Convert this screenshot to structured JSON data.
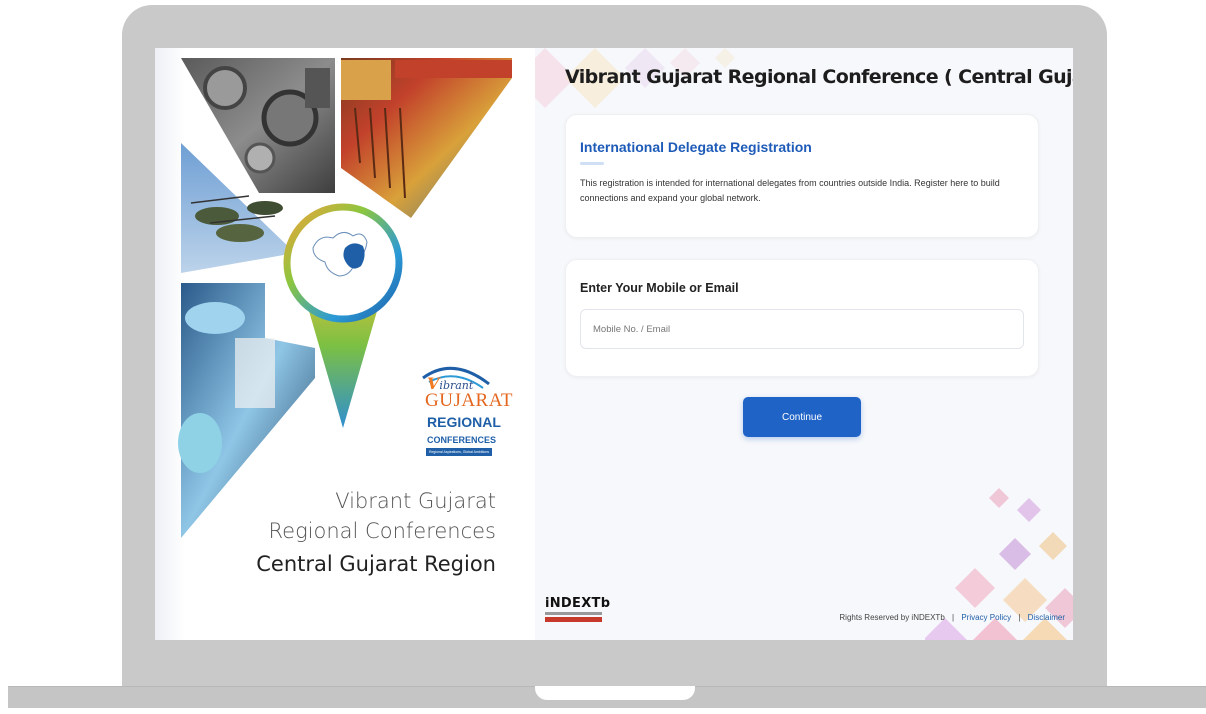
{
  "left": {
    "logo": {
      "vibrant": "ibrant",
      "vibrant_initial": "V",
      "gujarat": "GUJARAT",
      "regional": "REGIONAL",
      "conferences": "CONFERENCES",
      "tagline": "Regional Aspirations, Global Ambitions"
    },
    "title_line1": "Vibrant Gujarat",
    "title_line2": "Regional Conferences",
    "title_line3": "Central Gujarat Region"
  },
  "main": {
    "title": "Vibrant Gujarat Regional Conference ( Central Gujarat )",
    "registration": {
      "title": "International Delegate Registration",
      "description": "This registration is intended for international delegates from countries outside India. Register here to build connections and expand your global network."
    },
    "login": {
      "label": "Enter Your Mobile or Email",
      "placeholder": "Mobile No. / Email",
      "value": ""
    },
    "continue_label": "Continue"
  },
  "footer": {
    "logo_text": "iNDEXTb",
    "rights": "Rights Reserved by iNDEXTb",
    "separator": "|",
    "privacy": "Privacy Policy",
    "disclaimer": "Disclaimer"
  },
  "colors": {
    "accent": "#1f63c7",
    "heading_blue": "#1e5bb8",
    "frame": "#c9c9c9",
    "logo_orange": "#e4661f"
  },
  "icons": [
    "gujarat-map-pin-icon",
    "vibrant-gujarat-logo",
    "indextb-logo"
  ]
}
